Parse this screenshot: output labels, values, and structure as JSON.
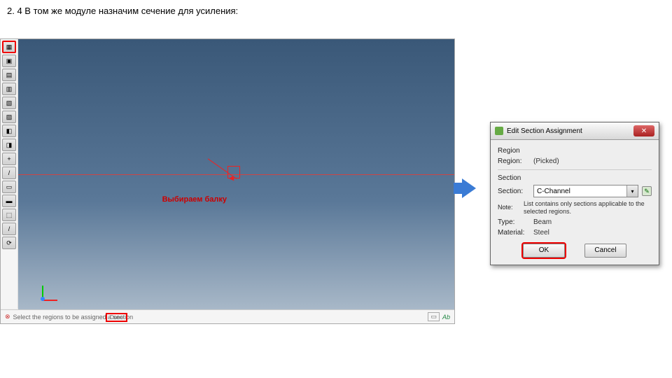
{
  "caption": "2. 4 В том же модуле назначим сечение для усиления:",
  "viewport": {
    "annotation": "Выбираем балку"
  },
  "statusbar": {
    "prompt": "Select the regions to be assigned a section",
    "done": "Done",
    "brand": "Ab"
  },
  "dialog": {
    "title": "Edit Section Assignment",
    "close_symbol": "✕",
    "region_group": "Region",
    "region_label": "Region:",
    "region_value": "(Picked)",
    "section_group": "Section",
    "section_label": "Section:",
    "section_value": "C-Channel",
    "note_label": "Note:",
    "note_text": "List contains only sections applicable to the selected regions.",
    "type_label": "Type:",
    "type_value": "Beam",
    "material_label": "Material:",
    "material_value": "Steel",
    "ok": "OK",
    "cancel": "Cancel",
    "dropdown_arrow": "▾",
    "create_glyph": "✎"
  }
}
